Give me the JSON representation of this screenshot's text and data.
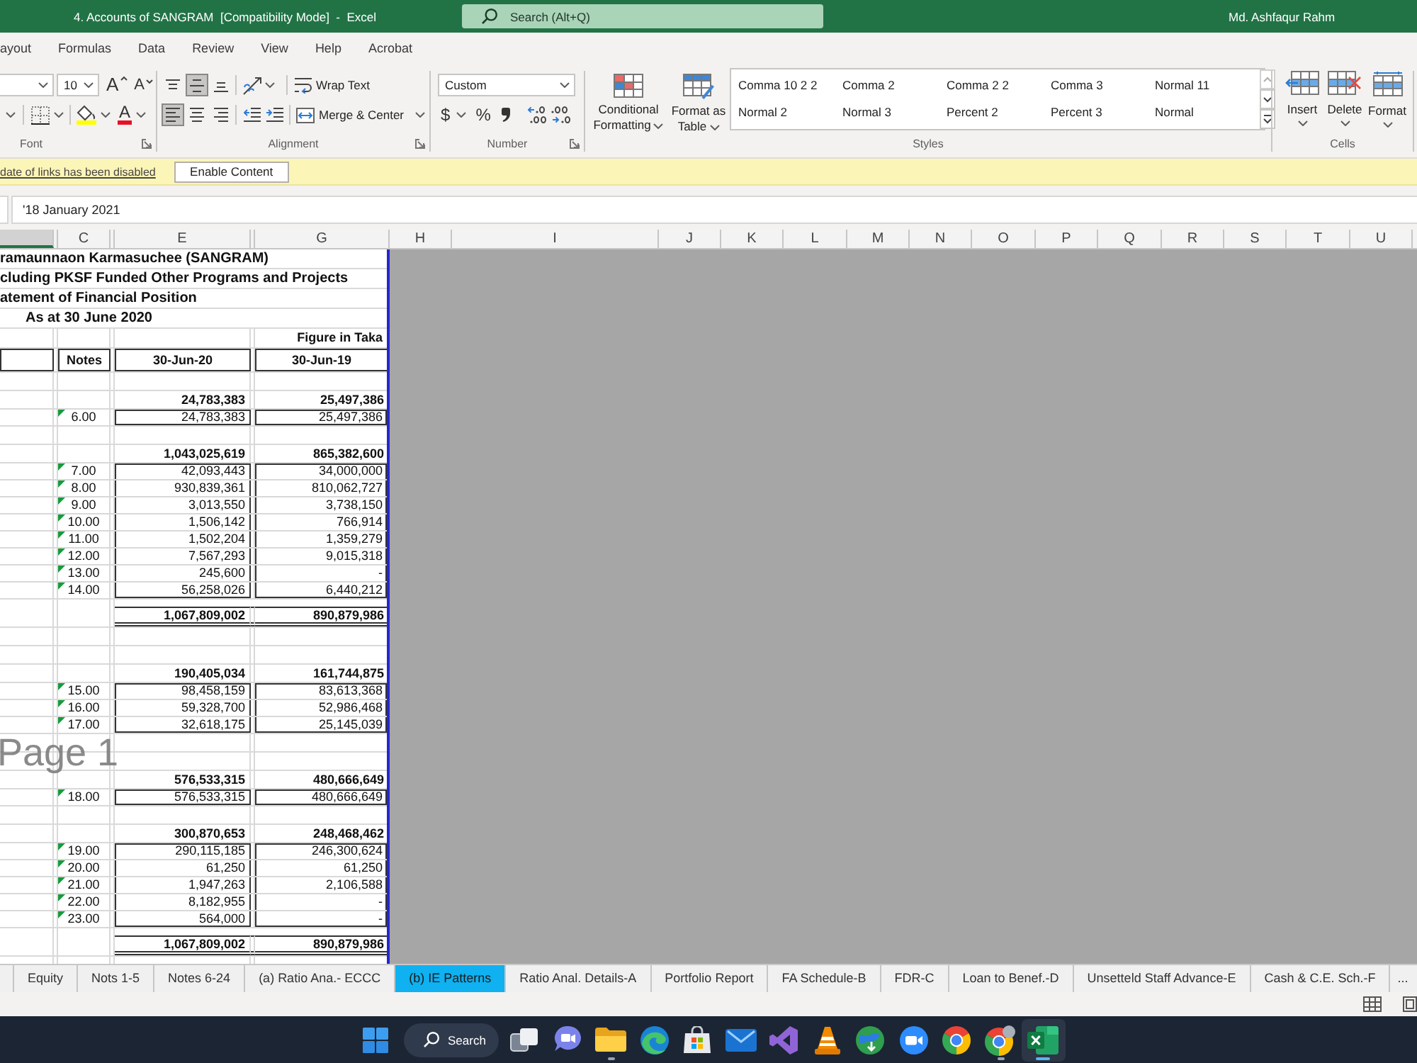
{
  "window": {
    "title": "4. Accounts of SANGRAM  [Compatibility Mode]  -  Excel",
    "search": {
      "placeholder": "Search (Alt+Q)"
    },
    "user": "Md. Ashfaqur Rahm"
  },
  "ribbon_tabs": [
    {
      "label": "ayout",
      "selected": false
    },
    {
      "label": "Formulas",
      "selected": false
    },
    {
      "label": "Data",
      "selected": false
    },
    {
      "label": "Review",
      "selected": false
    },
    {
      "label": "View",
      "selected": false
    },
    {
      "label": "Help",
      "selected": false
    },
    {
      "label": "Acrobat",
      "selected": false
    }
  ],
  "ribbon": {
    "font": {
      "label": "Font",
      "size": "10",
      "grow": "A",
      "shrink": "A",
      "foreground_glyph": "A"
    },
    "alignment": {
      "label": "Alignment",
      "vertical": [
        {
          "kind": "top",
          "on": false
        },
        {
          "kind": "middle",
          "on": true
        },
        {
          "kind": "bottom",
          "on": false
        }
      ],
      "horizontal": [
        {
          "kind": "left",
          "on": true
        },
        {
          "kind": "center",
          "on": false
        },
        {
          "kind": "right",
          "on": false
        }
      ],
      "wrap": "Wrap Text",
      "merge": "Merge & Center"
    },
    "number": {
      "label": "Number",
      "format": "Custom",
      "currency": "$",
      "percent": "%"
    },
    "styles": {
      "label": "Styles",
      "conditional": "Conditional Formatting",
      "table": "Format as Table",
      "gallery": [
        {
          "label": "Comma 10 2 2",
          "selected": false
        },
        {
          "label": "Comma 2",
          "selected": false
        },
        {
          "label": "Comma 2 2",
          "selected": false
        },
        {
          "label": "Comma 3",
          "selected": false
        },
        {
          "label": "Normal 11",
          "selected": false
        },
        {
          "label": "Normal 2",
          "selected": false
        },
        {
          "label": "Normal 3",
          "selected": false
        },
        {
          "label": "Percent 2",
          "selected": false
        },
        {
          "label": "Percent 3",
          "selected": false
        },
        {
          "label": "Normal",
          "selected": false
        }
      ]
    },
    "cells": {
      "label": "Cells",
      "buttons": [
        {
          "kind": "insert",
          "label": "Insert"
        },
        {
          "kind": "delete",
          "label": "Delete"
        },
        {
          "kind": "format",
          "label": "Format"
        }
      ]
    }
  },
  "message_bar": {
    "text": "date of links has been disabled",
    "button": "Enable Content"
  },
  "formula_bar": {
    "value": "'18 January 2021"
  },
  "columns": [
    {
      "selected": true
    },
    {
      "selected": false
    },
    {
      "label": "C",
      "selected": false
    },
    {
      "selected": false
    },
    {
      "label": "E",
      "selected": false
    },
    {
      "selected": false
    },
    {
      "label": "G",
      "selected": false
    },
    {
      "label": "H",
      "selected": false
    },
    {
      "label": "I",
      "selected": false
    },
    {
      "label": "J",
      "selected": false
    },
    {
      "label": "K",
      "selected": false
    },
    {
      "label": "L",
      "selected": false
    },
    {
      "label": "M",
      "selected": false
    },
    {
      "label": "N",
      "selected": false
    },
    {
      "label": "O",
      "selected": false
    },
    {
      "label": "P",
      "selected": false
    },
    {
      "label": "Q",
      "selected": false
    },
    {
      "label": "R",
      "selected": false
    },
    {
      "label": "S",
      "selected": false
    },
    {
      "label": "T",
      "selected": false
    },
    {
      "label": "U",
      "selected": false
    }
  ],
  "sheet": {
    "rows": [
      {
        "kind": "title",
        "text": "ramaunnaon Karmasuchee (SANGRAM)"
      },
      {
        "kind": "title",
        "text": "cluding PKSF Funded Other Programs and Projects"
      },
      {
        "kind": "title",
        "text": "atement of Financial Position"
      },
      {
        "kind": "dateline",
        "text": "As at 30 June 2020"
      },
      {
        "kind": "unit",
        "text": "Figure in Taka"
      },
      {
        "kind": "header",
        "notes": "Notes",
        "current": "30-Jun-20",
        "previous": "30-Jun-19"
      },
      {
        "kind": "blank"
      },
      {
        "kind": "subtotal",
        "current": "24,783,383",
        "previous": "25,497,386"
      },
      {
        "kind": "group",
        "items": [
          {
            "note": "6.00",
            "flagged": true,
            "current": "24,783,383",
            "previous": "25,497,386"
          }
        ]
      },
      {
        "kind": "blank"
      },
      {
        "kind": "subtotal",
        "current": "1,043,025,619",
        "previous": "865,382,600"
      },
      {
        "kind": "group",
        "items": [
          {
            "note": "7.00",
            "flagged": true,
            "current": "42,093,443",
            "previous": "34,000,000"
          },
          {
            "note": "8.00",
            "flagged": true,
            "current": "930,839,361",
            "previous": "810,062,727"
          },
          {
            "note": "9.00",
            "flagged": true,
            "current": "3,013,550",
            "previous": "3,738,150"
          },
          {
            "note": "10.00",
            "flagged": true,
            "current": "1,506,142",
            "previous": "766,914"
          },
          {
            "note": "11.00",
            "flagged": true,
            "current": "1,502,204",
            "previous": "1,359,279"
          },
          {
            "note": "12.00",
            "flagged": true,
            "current": "7,567,293",
            "previous": "9,015,318"
          },
          {
            "note": "13.00",
            "flagged": true,
            "current": "245,600",
            "previous": "-"
          },
          {
            "note": "14.00",
            "flagged": true,
            "current": "56,258,026",
            "previous": "6,440,212"
          }
        ]
      },
      {
        "kind": "total",
        "current": "1,067,809,002",
        "previous": "890,879,986"
      },
      {
        "kind": "blank"
      },
      {
        "kind": "blank"
      },
      {
        "kind": "subtotal",
        "current": "190,405,034",
        "previous": "161,744,875"
      },
      {
        "kind": "group",
        "items": [
          {
            "note": "15.00",
            "flagged": true,
            "current": "98,458,159",
            "previous": "83,613,368"
          },
          {
            "note": "16.00",
            "flagged": true,
            "current": "59,328,700",
            "previous": "52,986,468"
          },
          {
            "note": "17.00",
            "flagged": true,
            "current": "32,618,175",
            "previous": "25,145,039"
          }
        ]
      },
      {
        "kind": "blank"
      },
      {
        "kind": "blank"
      },
      {
        "kind": "subtotal",
        "current": "576,533,315",
        "previous": "480,666,649"
      },
      {
        "kind": "group",
        "items": [
          {
            "note": "18.00",
            "flagged": true,
            "current": "576,533,315",
            "previous": "480,666,649"
          }
        ]
      },
      {
        "kind": "blank"
      },
      {
        "kind": "subtotal",
        "current": "300,870,653",
        "previous": "248,468,462"
      },
      {
        "kind": "group",
        "items": [
          {
            "note": "19.00",
            "flagged": true,
            "current": "290,115,185",
            "previous": "246,300,624"
          },
          {
            "note": "20.00",
            "flagged": true,
            "current": "61,250",
            "previous": "61,250"
          },
          {
            "note": "21.00",
            "flagged": true,
            "current": "1,947,263",
            "previous": "2,106,588"
          },
          {
            "note": "22.00",
            "flagged": true,
            "current": "8,182,955",
            "previous": "-"
          },
          {
            "note": "23.00",
            "flagged": true,
            "current": "564,000",
            "previous": "-"
          }
        ]
      },
      {
        "kind": "total",
        "current": "1,067,809,002",
        "previous": "890,879,986"
      },
      {
        "kind": "blank"
      }
    ],
    "page_label": "Page 1"
  },
  "sheet_tabs": [
    {
      "label": "Equity",
      "selected": false
    },
    {
      "label": "Nots 1-5",
      "selected": false
    },
    {
      "label": "Notes 6-24",
      "selected": false
    },
    {
      "label": "(a) Ratio Ana.- ECCC",
      "selected": false
    },
    {
      "label": "(b) IE Patterns",
      "selected": true
    },
    {
      "label": "Ratio Anal. Details-A",
      "selected": false
    },
    {
      "label": "Portfolio Report",
      "selected": false
    },
    {
      "label": "FA Schedule-B",
      "selected": false
    },
    {
      "label": "FDR-C",
      "selected": false
    },
    {
      "label": "Loan to Benef.-D",
      "selected": false
    },
    {
      "label": "Unsetteld Staff Advance-E",
      "selected": false
    },
    {
      "label": "Cash & C.E. Sch.-F",
      "selected": false
    }
  ],
  "more_tabs": "...",
  "taskbar": {
    "search": "Search",
    "apps": [
      {
        "kind": "taskview",
        "open": false,
        "active": false
      },
      {
        "kind": "chat",
        "open": false,
        "active": false
      },
      {
        "kind": "folder",
        "open": true,
        "active": false
      },
      {
        "kind": "swirl",
        "open": false,
        "active": false
      },
      {
        "kind": "bag",
        "open": false,
        "active": false
      },
      {
        "kind": "mail",
        "open": false,
        "active": false
      },
      {
        "kind": "ribbon",
        "open": false,
        "active": false
      },
      {
        "kind": "cone",
        "open": false,
        "active": false
      },
      {
        "kind": "globe",
        "open": false,
        "active": false
      },
      {
        "kind": "camera",
        "open": false,
        "active": false
      },
      {
        "kind": "wheel",
        "open": false,
        "active": false
      },
      {
        "kind": "wheelbadge",
        "open": true,
        "active": false
      },
      {
        "kind": "sheet",
        "open": true,
        "active": true
      }
    ]
  }
}
